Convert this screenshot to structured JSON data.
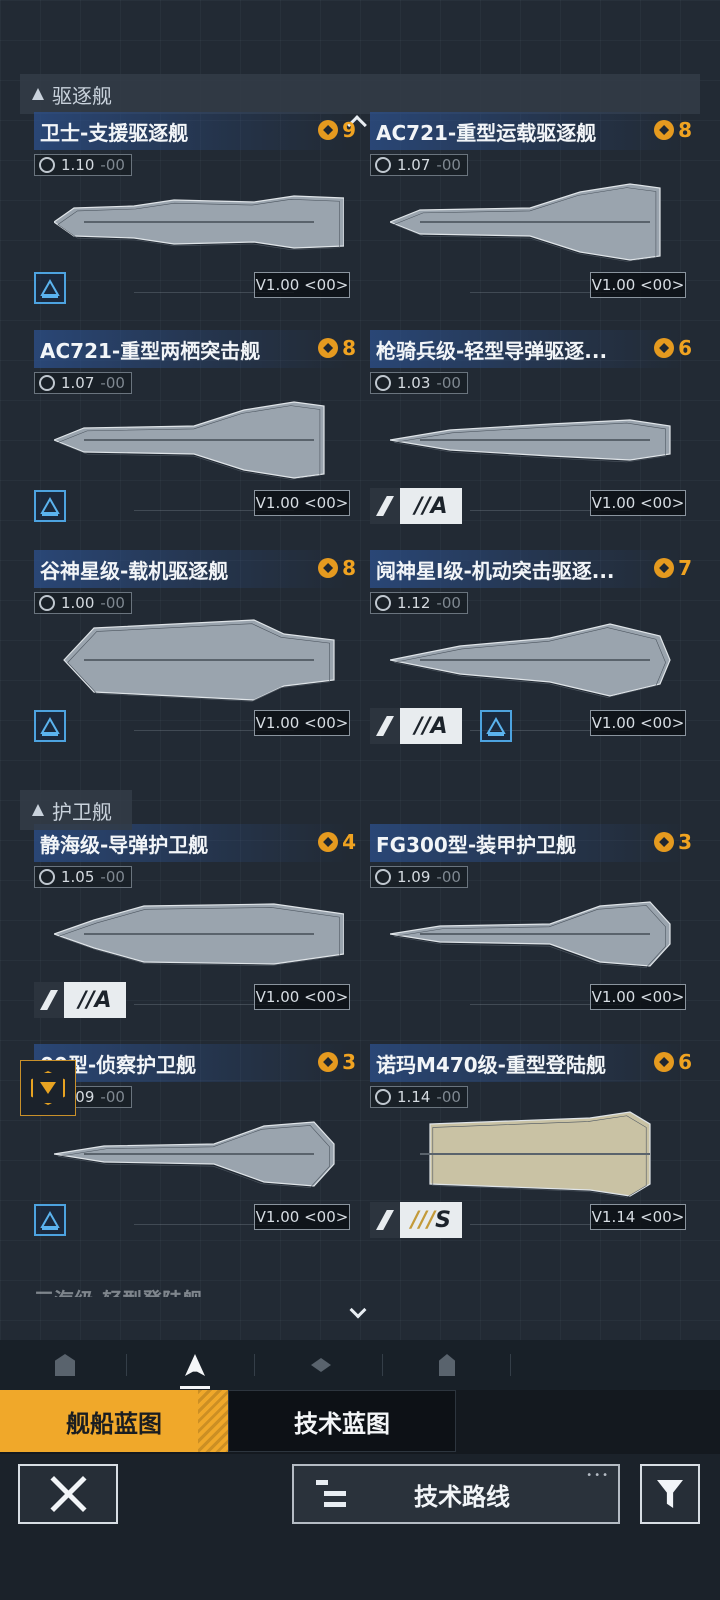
{
  "sections": {
    "destroyer": "驱逐舰",
    "frigate": "护卫舰"
  },
  "cards": [
    {
      "name": "卫士-支援驱逐舰",
      "rank": "9",
      "ver": "1.10",
      "ver_suffix": "-00",
      "badge_icon": "missile-icon",
      "version_label": "V1.00 <00>",
      "trait": "support-trait-icon"
    },
    {
      "name": "AC721-重型运载驱逐舰",
      "rank": "8",
      "ver": "1.07",
      "ver_suffix": "-00",
      "badge_icon": "globe-icon",
      "version_label": "V1.00 <00>"
    },
    {
      "name": "AC721-重型两栖突击舰",
      "rank": "8",
      "ver": "1.07",
      "ver_suffix": "-00",
      "badge_icon": "globe-icon",
      "version_label": "V1.00 <00>",
      "trait": "landing-trait-icon"
    },
    {
      "name": "枪骑兵级-轻型导弹驱逐...",
      "rank": "6",
      "ver": "1.03",
      "ver_suffix": "-00",
      "badge_icon": "missile-icon",
      "version_label": "V1.00 <00>",
      "grade": "A",
      "grade_prefix": "//"
    },
    {
      "name": "谷神星级-载机驱逐舰",
      "rank": "8",
      "ver": "1.00",
      "ver_suffix": "-00",
      "badge_icon": "gear-globe-icon",
      "version_label": "V1.00 <00>",
      "trait": "carrier-trait-icon"
    },
    {
      "name": "阋神星I级-机动突击驱逐...",
      "rank": "7",
      "ver": "1.12",
      "ver_suffix": "-00",
      "badge_icon": "gear-globe-icon",
      "version_label": "V1.00 <00>",
      "grade": "A",
      "grade_prefix": "//",
      "trait": "assault-trait-icon"
    },
    {
      "name": "静海级-导弹护卫舰",
      "rank": "4",
      "ver": "1.05",
      "ver_suffix": "-00",
      "badge_icon": "gear-globe-icon",
      "version_label": "V1.00 <00>",
      "grade": "A",
      "grade_prefix": "//"
    },
    {
      "name": "FG300型-装甲护卫舰",
      "rank": "3",
      "ver": "1.09",
      "ver_suffix": "-00",
      "badge_icon": "globe-icon",
      "version_label": "V1.00 <00>"
    },
    {
      "name": "00型-侦察护卫舰",
      "rank": "3",
      "ver": "1.09",
      "ver_suffix": "-00",
      "badge_icon": "globe-icon",
      "version_label": "V1.00 <00>",
      "trait": "scout-trait-icon"
    },
    {
      "name": "诺玛M470级-重型登陆舰",
      "rank": "6",
      "ver": "1.14",
      "ver_suffix": "-00",
      "badge_icon": "brand-icon",
      "version_label": "V1.14 <00>",
      "grade": "S",
      "grade_prefix": "///"
    }
  ],
  "partial_card_name": "三海级-轻型登陆舰",
  "category_tabs": [
    "base-icon",
    "ship-icon",
    "layers-icon",
    "tower-icon"
  ],
  "blueprint_tabs": {
    "ship": "舰船蓝图",
    "tech": "技术蓝图"
  },
  "bottom": {
    "route_label": "技术路线"
  },
  "colors": {
    "accent": "#f0a82a",
    "rank": "#f0a321",
    "trait_border": "#4da3e0"
  }
}
